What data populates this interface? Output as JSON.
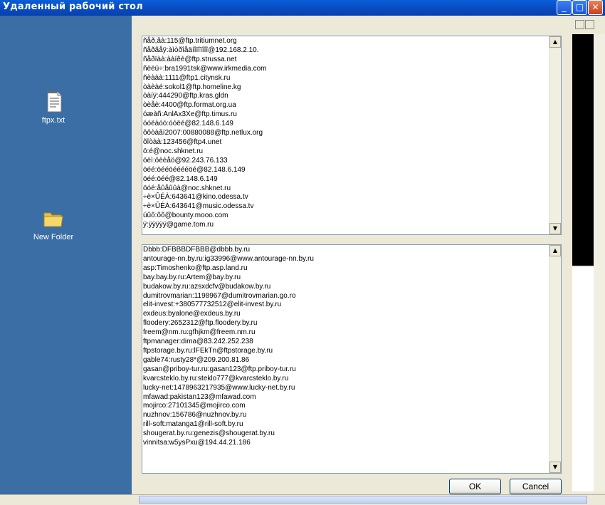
{
  "window": {
    "title": "Удаленный рабочий стол",
    "minimize_glyph": "_",
    "maximize_glyph": "□",
    "close_glyph": "✕"
  },
  "desktop": {
    "icons": [
      {
        "label": "ftpx.txt",
        "icon": "text-file-icon"
      },
      {
        "label": "New Folder",
        "icon": "folder-icon"
      }
    ]
  },
  "dialog": {
    "top_list": [
      "ñåð,ãà:115@ftp.tritiumnet.org",
      "ñåðãåÿ:àìòðîåäíîïîïîîî@192.168.2.10.",
      "ñåðïàà:ààíêè@ftp.strussa.net",
      "ñëëü÷:bra1991tsk@www.irkmedia.com",
      "ñèààà:1111@ftp1.citynsk.ru",
      "òàèàé:sokol1@ftp.homeline.kg",
      "òàíÿ:444290@ftp.kras.gldn",
      "òèåè:4400@ftp.format.org.ua",
      "óæàñ:AnlAx3Xe@ftp.timus.ru",
      "óóëàóó:óóëé@82.148.6.149",
      "ôôòàãí2007:00880088@ftp.netlux.org",
      "õîòàà:123456@ftp4.unet",
      "ö:é@noc.shknet.ru",
      "öèì:öèèåö@92.243.76.133",
      "öéé:öééöééééöé@82.148.6.149",
      "öéé:öéé@82.148.6.149",
      "öóé:åûåûûà@noc.shknet.ru",
      "÷è×ÛÉÀ:643641@kino.odessa.tv",
      "÷è×ÛÉÀ:643641@music.odessa.tv",
      "úûõ:õõ@bounty.mooo.com",
      "ÿ:ÿÿÿÿÿ@game.tom.ru"
    ],
    "bottom_list": [
      "Dbbb:DFBBBDFBBB@dbbb.by.ru",
      "antourage-nn.by.ru:ig33996@www.antourage-nn.by.ru",
      "asp:Timoshenko@ftp.asp.land.ru",
      "bay.bay.by.ru:Artem@bay.by.ru",
      "budakow.by.ru:azsxdcfv@budakow.by.ru",
      "dumitrovmarian:1198967@dumitrovmarian.go.ro",
      "elit-invest:+380577732512@elit-invest.by.ru",
      "exdeus:byalone@exdeus.by.ru",
      "floodery:2652312@ftp.floodery.by.ru",
      "freem@nm.ru:gfhjkm@freem.nm.ru",
      "ftpmanager:dima@83.242.252.238",
      "ftpstorage.by.ru:lFEkTn@ftpstorage.by.ru",
      "gable74:rusty28*@209.200.81.86",
      "gasan@priboy-tur.ru:gasan123@ftp.priboy-tur.ru",
      "kvarcsteklo.by.ru:steklo777@kvarcsteklo.by.ru",
      "lucky-net:1478963217935@www.lucky-net.by.ru",
      "mfawad:pakistan123@mfawad.com",
      "mojirco:27101345@mojirco.com",
      "nuzhnov:156786@nuzhnov.by.ru",
      "rill-soft:matanga1@rill-soft.by.ru",
      "shougerat.by.ru:genezis@shougerat.by.ru",
      "vinnitsa:w5ysPxu@194.44.21.186"
    ],
    "ok_label": "OK",
    "cancel_label": "Cancel"
  },
  "colors": {
    "desktop_bg": "#3a6ea5",
    "titlebar": "#0b4fc4",
    "dialog_bg": "#ece9d8"
  }
}
